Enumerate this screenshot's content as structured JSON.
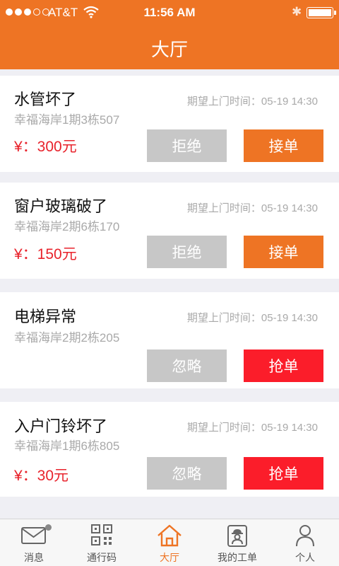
{
  "status": {
    "carrier": "AT&T",
    "time": "11:56 AM"
  },
  "header": {
    "title": "大厅"
  },
  "orders": [
    {
      "title": "水管坏了",
      "time": "期望上门时间：05-19  14:30",
      "address": "幸福海岸1期3栋507",
      "price": "¥：300元",
      "left_btn": "拒绝",
      "right_btn": "接单",
      "right_style": "orange"
    },
    {
      "title": "窗户玻璃破了",
      "time": "期望上门时间：05-19  14:30",
      "address": "幸福海岸2期6栋170",
      "price": "¥：150元",
      "left_btn": "拒绝",
      "right_btn": "接单",
      "right_style": "orange"
    },
    {
      "title": "电梯异常",
      "time": "期望上门时间：05-19  14:30",
      "address": "幸福海岸2期2栋205",
      "price": "",
      "left_btn": "忽略",
      "right_btn": "抢单",
      "right_style": "red"
    },
    {
      "title": "入户门铃坏了",
      "time": "期望上门时间：05-19  14:30",
      "address": "幸福海岸1期6栋805",
      "price": "¥：30元",
      "left_btn": "忽略",
      "right_btn": "抢单",
      "right_style": "red"
    }
  ],
  "tabbar": {
    "items": [
      {
        "label": "消息",
        "icon": "mail-icon"
      },
      {
        "label": "通行码",
        "icon": "qrcode-icon"
      },
      {
        "label": "大厅",
        "icon": "home-icon",
        "active": true
      },
      {
        "label": "我的工单",
        "icon": "worker-icon"
      },
      {
        "label": "个人",
        "icon": "person-icon"
      }
    ]
  },
  "colors": {
    "accent": "#ee7424",
    "danger": "#fb1d2a",
    "price": "#e8232c",
    "disabled": "#c7c7c7"
  }
}
